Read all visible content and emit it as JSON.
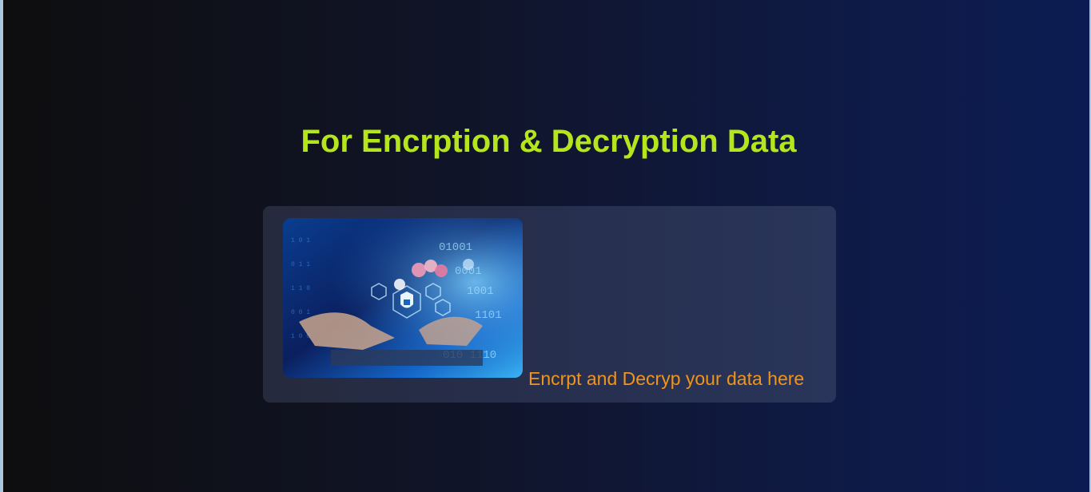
{
  "header": {
    "title": "For Encrption & Decryption Data"
  },
  "card": {
    "image_icon": "cyber-security-lock-icon",
    "caption": "Encrpt and Decryp your data here"
  },
  "colors": {
    "title": "#b5e51b",
    "caption": "#f0941b",
    "card_background": "#272f4e",
    "page_gradient_start": "#0e0e0f",
    "page_gradient_end": "#0c1c52"
  }
}
